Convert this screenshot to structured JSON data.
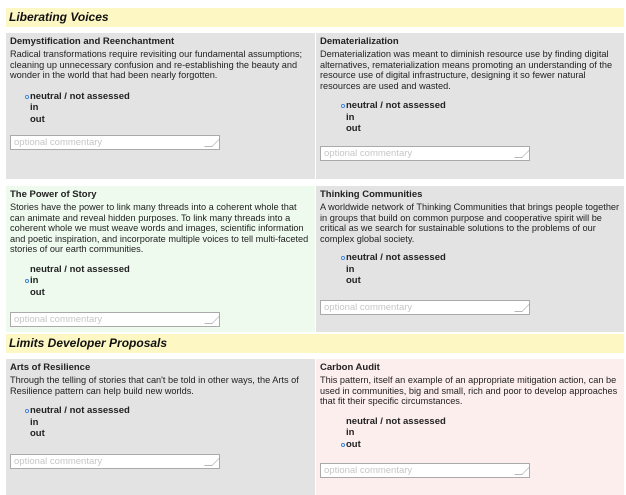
{
  "sections": [
    {
      "title": "Liberating Voices"
    },
    {
      "title": "Limits Developer Proposals"
    }
  ],
  "options": {
    "neutral": "neutral / not assessed",
    "in": "in",
    "out": "out"
  },
  "commentary_placeholder": "optional commentary",
  "cards": [
    {
      "title": "Demystification and Reenchantment",
      "description": "Radical transformations require revisiting our fundamental assumptions; cleaning up unnecessary confusion and re-establishing the beauty and wonder in the world that had been nearly forgotten.",
      "selected": "neutral / not assessed"
    },
    {
      "title": "Dematerialization",
      "description": "Dematerialization was meant to diminish resource use by finding digital alternatives, rematerialization means promoting an understanding of the resource use of digital infrastructure, designing it so fewer natural resources are used and wasted.",
      "selected": "neutral / not assessed"
    },
    {
      "title": "The Power of Story",
      "description": "Stories have the power to link many threads into a coherent whole that can animate and reveal hidden purposes. To link many threads into a coherent whole we must weave words and images, scientific information and poetic inspiration, and incorporate multiple voices to tell multi-faceted stories of our earth communities.",
      "selected": "in"
    },
    {
      "title": "Thinking Communities",
      "description": "A worldwide network of Thinking Communities that brings people together in groups that build on common purpose and cooperative spirit will be critical as we search for sustainable solutions to the problems of our complex global society.",
      "selected": "neutral / not assessed"
    },
    {
      "title": "Arts of Resilience",
      "description": "Through the telling of stories that can't be told in other ways, the Arts of Resilience pattern can help build new worlds.",
      "selected": "neutral / not assessed"
    },
    {
      "title": "Carbon Audit",
      "description": "This pattern, itself an example of an appropriate mitigation action, can be used in communities, big and small, rich and poor to develop approaches that fit their specific circumstances.",
      "selected": "out"
    }
  ]
}
